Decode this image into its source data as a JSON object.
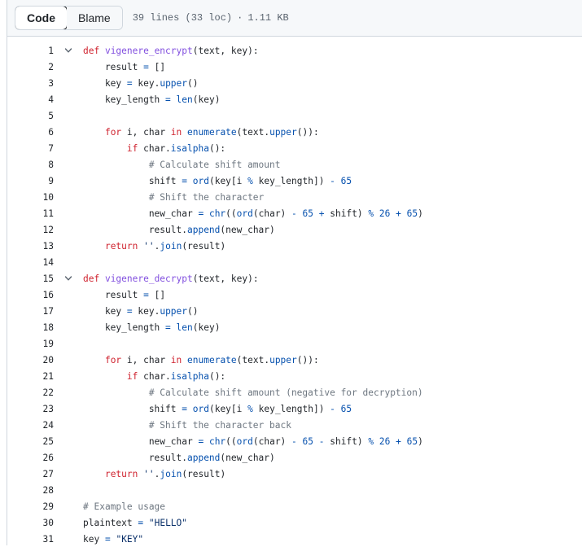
{
  "toolbar": {
    "code_label": "Code",
    "blame_label": "Blame",
    "lines_info": "39 lines (33 loc)",
    "separator": "·",
    "size": "1.11 KB"
  },
  "colors": {
    "keyword": "#cf222e",
    "function": "#8250df",
    "builtin": "#0550ae",
    "string": "#0a3069",
    "comment": "#6e7781"
  },
  "code_lines": [
    {
      "n": "1",
      "fold": true,
      "tokens": [
        [
          "kw",
          "def "
        ],
        [
          "fn",
          "vigenere_encrypt"
        ],
        [
          "txt",
          "(text, key):"
        ]
      ]
    },
    {
      "n": "2",
      "tokens": [
        [
          "txt",
          "    result "
        ],
        [
          "op",
          "="
        ],
        [
          "txt",
          " []"
        ]
      ]
    },
    {
      "n": "3",
      "tokens": [
        [
          "txt",
          "    key "
        ],
        [
          "op",
          "="
        ],
        [
          "txt",
          " key."
        ],
        [
          "bi",
          "upper"
        ],
        [
          "txt",
          "()"
        ]
      ]
    },
    {
      "n": "4",
      "tokens": [
        [
          "txt",
          "    key_length "
        ],
        [
          "op",
          "="
        ],
        [
          "txt",
          " "
        ],
        [
          "bi",
          "len"
        ],
        [
          "txt",
          "(key)"
        ]
      ]
    },
    {
      "n": "5",
      "tokens": []
    },
    {
      "n": "6",
      "tokens": [
        [
          "txt",
          "    "
        ],
        [
          "kw",
          "for"
        ],
        [
          "txt",
          " i, char "
        ],
        [
          "kw",
          "in"
        ],
        [
          "txt",
          " "
        ],
        [
          "bi",
          "enumerate"
        ],
        [
          "txt",
          "(text."
        ],
        [
          "bi",
          "upper"
        ],
        [
          "txt",
          "()):"
        ]
      ]
    },
    {
      "n": "7",
      "tokens": [
        [
          "txt",
          "        "
        ],
        [
          "kw",
          "if"
        ],
        [
          "txt",
          " char."
        ],
        [
          "bi",
          "isalpha"
        ],
        [
          "txt",
          "():"
        ]
      ]
    },
    {
      "n": "8",
      "tokens": [
        [
          "txt",
          "            "
        ],
        [
          "cm",
          "# Calculate shift amount"
        ]
      ]
    },
    {
      "n": "9",
      "tokens": [
        [
          "txt",
          "            shift "
        ],
        [
          "op",
          "="
        ],
        [
          "txt",
          " "
        ],
        [
          "bi",
          "ord"
        ],
        [
          "txt",
          "(key[i "
        ],
        [
          "op",
          "%"
        ],
        [
          "txt",
          " key_length]) "
        ],
        [
          "op",
          "-"
        ],
        [
          "txt",
          " "
        ],
        [
          "num",
          "65"
        ]
      ]
    },
    {
      "n": "10",
      "tokens": [
        [
          "txt",
          "            "
        ],
        [
          "cm",
          "# Shift the character"
        ]
      ]
    },
    {
      "n": "11",
      "tokens": [
        [
          "txt",
          "            new_char "
        ],
        [
          "op",
          "="
        ],
        [
          "txt",
          " "
        ],
        [
          "bi",
          "chr"
        ],
        [
          "txt",
          "(("
        ],
        [
          "bi",
          "ord"
        ],
        [
          "txt",
          "(char) "
        ],
        [
          "op",
          "-"
        ],
        [
          "txt",
          " "
        ],
        [
          "num",
          "65"
        ],
        [
          "txt",
          " "
        ],
        [
          "op",
          "+"
        ],
        [
          "txt",
          " shift) "
        ],
        [
          "op",
          "%"
        ],
        [
          "txt",
          " "
        ],
        [
          "num",
          "26"
        ],
        [
          "txt",
          " "
        ],
        [
          "op",
          "+"
        ],
        [
          "txt",
          " "
        ],
        [
          "num",
          "65"
        ],
        [
          "txt",
          ")"
        ]
      ]
    },
    {
      "n": "12",
      "tokens": [
        [
          "txt",
          "            result."
        ],
        [
          "bi",
          "append"
        ],
        [
          "txt",
          "(new_char)"
        ]
      ]
    },
    {
      "n": "13",
      "tokens": [
        [
          "txt",
          "    "
        ],
        [
          "kw",
          "return"
        ],
        [
          "txt",
          " "
        ],
        [
          "st",
          "''"
        ],
        [
          "txt",
          "."
        ],
        [
          "bi",
          "join"
        ],
        [
          "txt",
          "(result)"
        ]
      ]
    },
    {
      "n": "14",
      "tokens": []
    },
    {
      "n": "15",
      "fold": true,
      "tokens": [
        [
          "kw",
          "def "
        ],
        [
          "fn",
          "vigenere_decrypt"
        ],
        [
          "txt",
          "(text, key):"
        ]
      ]
    },
    {
      "n": "16",
      "tokens": [
        [
          "txt",
          "    result "
        ],
        [
          "op",
          "="
        ],
        [
          "txt",
          " []"
        ]
      ]
    },
    {
      "n": "17",
      "tokens": [
        [
          "txt",
          "    key "
        ],
        [
          "op",
          "="
        ],
        [
          "txt",
          " key."
        ],
        [
          "bi",
          "upper"
        ],
        [
          "txt",
          "()"
        ]
      ]
    },
    {
      "n": "18",
      "tokens": [
        [
          "txt",
          "    key_length "
        ],
        [
          "op",
          "="
        ],
        [
          "txt",
          " "
        ],
        [
          "bi",
          "len"
        ],
        [
          "txt",
          "(key)"
        ]
      ]
    },
    {
      "n": "19",
      "tokens": []
    },
    {
      "n": "20",
      "tokens": [
        [
          "txt",
          "    "
        ],
        [
          "kw",
          "for"
        ],
        [
          "txt",
          " i, char "
        ],
        [
          "kw",
          "in"
        ],
        [
          "txt",
          " "
        ],
        [
          "bi",
          "enumerate"
        ],
        [
          "txt",
          "(text."
        ],
        [
          "bi",
          "upper"
        ],
        [
          "txt",
          "()):"
        ]
      ]
    },
    {
      "n": "21",
      "tokens": [
        [
          "txt",
          "        "
        ],
        [
          "kw",
          "if"
        ],
        [
          "txt",
          " char."
        ],
        [
          "bi",
          "isalpha"
        ],
        [
          "txt",
          "():"
        ]
      ]
    },
    {
      "n": "22",
      "tokens": [
        [
          "txt",
          "            "
        ],
        [
          "cm",
          "# Calculate shift amount (negative for decryption)"
        ]
      ]
    },
    {
      "n": "23",
      "tokens": [
        [
          "txt",
          "            shift "
        ],
        [
          "op",
          "="
        ],
        [
          "txt",
          " "
        ],
        [
          "bi",
          "ord"
        ],
        [
          "txt",
          "(key[i "
        ],
        [
          "op",
          "%"
        ],
        [
          "txt",
          " key_length]) "
        ],
        [
          "op",
          "-"
        ],
        [
          "txt",
          " "
        ],
        [
          "num",
          "65"
        ]
      ]
    },
    {
      "n": "24",
      "tokens": [
        [
          "txt",
          "            "
        ],
        [
          "cm",
          "# Shift the character back"
        ]
      ]
    },
    {
      "n": "25",
      "tokens": [
        [
          "txt",
          "            new_char "
        ],
        [
          "op",
          "="
        ],
        [
          "txt",
          " "
        ],
        [
          "bi",
          "chr"
        ],
        [
          "txt",
          "(("
        ],
        [
          "bi",
          "ord"
        ],
        [
          "txt",
          "(char) "
        ],
        [
          "op",
          "-"
        ],
        [
          "txt",
          " "
        ],
        [
          "num",
          "65"
        ],
        [
          "txt",
          " "
        ],
        [
          "op",
          "-"
        ],
        [
          "txt",
          " shift) "
        ],
        [
          "op",
          "%"
        ],
        [
          "txt",
          " "
        ],
        [
          "num",
          "26"
        ],
        [
          "txt",
          " "
        ],
        [
          "op",
          "+"
        ],
        [
          "txt",
          " "
        ],
        [
          "num",
          "65"
        ],
        [
          "txt",
          ")"
        ]
      ]
    },
    {
      "n": "26",
      "tokens": [
        [
          "txt",
          "            result."
        ],
        [
          "bi",
          "append"
        ],
        [
          "txt",
          "(new_char)"
        ]
      ]
    },
    {
      "n": "27",
      "tokens": [
        [
          "txt",
          "    "
        ],
        [
          "kw",
          "return"
        ],
        [
          "txt",
          " "
        ],
        [
          "st",
          "''"
        ],
        [
          "txt",
          "."
        ],
        [
          "bi",
          "join"
        ],
        [
          "txt",
          "(result)"
        ]
      ]
    },
    {
      "n": "28",
      "tokens": []
    },
    {
      "n": "29",
      "tokens": [
        [
          "cm",
          "# Example usage"
        ]
      ]
    },
    {
      "n": "30",
      "tokens": [
        [
          "txt",
          "plaintext "
        ],
        [
          "op",
          "="
        ],
        [
          "txt",
          " "
        ],
        [
          "st",
          "\"HELLO\""
        ]
      ]
    },
    {
      "n": "31",
      "tokens": [
        [
          "txt",
          "key "
        ],
        [
          "op",
          "="
        ],
        [
          "txt",
          " "
        ],
        [
          "st",
          "\"KEY\""
        ]
      ]
    }
  ]
}
